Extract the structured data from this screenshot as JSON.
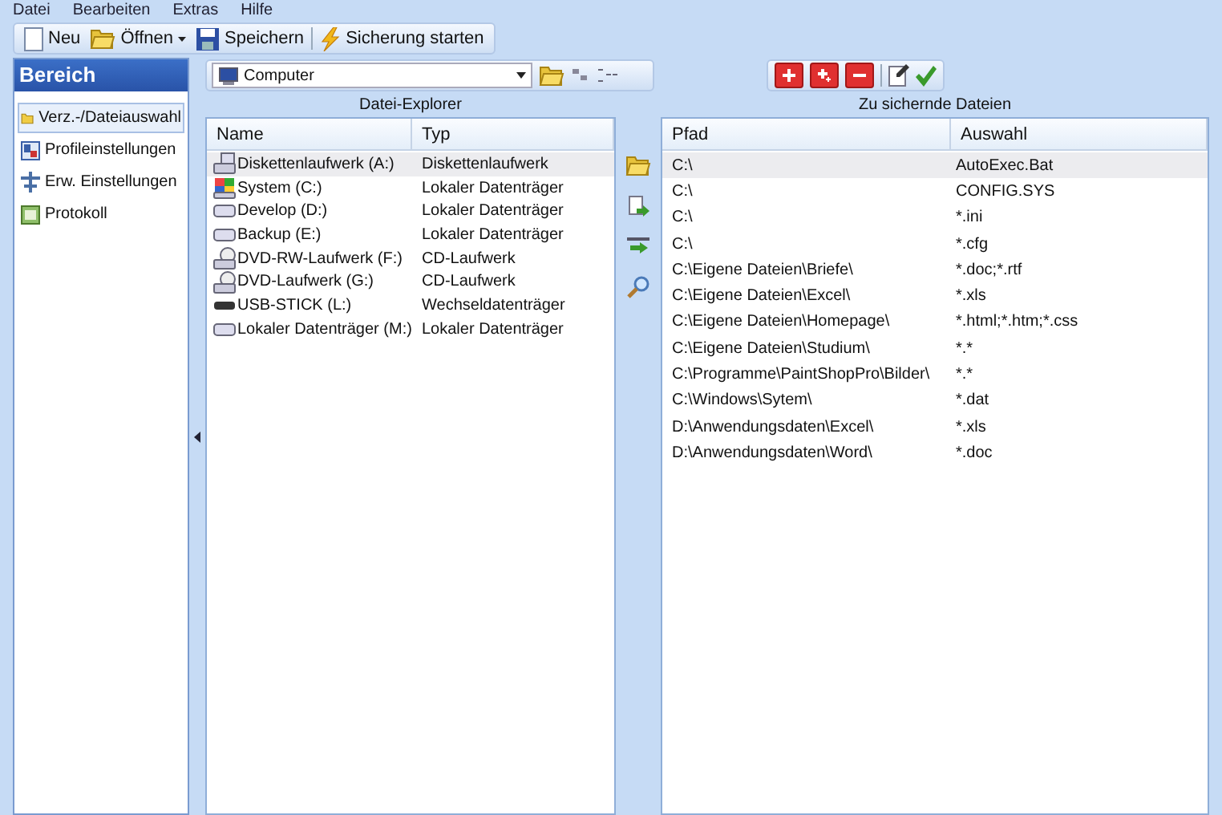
{
  "menu": [
    "Datei",
    "Bearbeiten",
    "Extras",
    "Hilfe"
  ],
  "toolbar": [
    {
      "kind": "new",
      "label": "Neu"
    },
    {
      "kind": "open",
      "label": "Öffnen",
      "dropdown": true
    },
    {
      "kind": "save",
      "label": "Speichern"
    },
    {
      "kind": "run",
      "label": "Sicherung starten"
    }
  ],
  "sidebar": {
    "title": "Bereich",
    "items": [
      {
        "kind": "folder",
        "label": "Verz.-/Dateiauswahl",
        "selected": true
      },
      {
        "kind": "profile",
        "label": "Profileinstellungen",
        "selected": false
      },
      {
        "kind": "advanced",
        "label": "Erw. Einstellungen",
        "selected": false
      },
      {
        "kind": "log",
        "label": "Protokoll",
        "selected": false
      }
    ]
  },
  "location": {
    "value": "Computer"
  },
  "explorer": {
    "title": "Datei-Explorer",
    "columns": [
      "Name",
      "Typ"
    ],
    "rows": [
      {
        "kind": "floppy",
        "name": "Diskettenlaufwerk (A:)",
        "type": "Diskettenlaufwerk",
        "selected": true
      },
      {
        "kind": "system",
        "name": "System (C:)",
        "type": "Lokaler Datenträger",
        "selected": false
      },
      {
        "kind": "disk",
        "name": "Develop (D:)",
        "type": "Lokaler Datenträger",
        "selected": false
      },
      {
        "kind": "disk",
        "name": "Backup (E:)",
        "type": "Lokaler Datenträger",
        "selected": false
      },
      {
        "kind": "dvd",
        "name": "DVD-RW-Laufwerk (F:)",
        "type": "CD-Laufwerk",
        "selected": false
      },
      {
        "kind": "dvd",
        "name": "DVD-Laufwerk (G:)",
        "type": "CD-Laufwerk",
        "selected": false
      },
      {
        "kind": "usb",
        "name": "USB-STICK (L:)",
        "type": "Wechseldatenträger",
        "selected": false
      },
      {
        "kind": "disk",
        "name": "Lokaler Datenträger (M:)",
        "type": "Lokaler Datenträger",
        "selected": false
      }
    ]
  },
  "backup": {
    "title": "Zu sichernde Dateien",
    "columns": [
      "Pfad",
      "Auswahl"
    ],
    "rows": [
      {
        "path": "C:\\",
        "selection": "AutoExec.Bat",
        "selected": true
      },
      {
        "path": "C:\\",
        "selection": "CONFIG.SYS",
        "selected": false
      },
      {
        "path": "C:\\",
        "selection": "*.ini",
        "selected": false
      },
      {
        "path": "C:\\",
        "selection": "*.cfg",
        "selected": false
      },
      {
        "path": "C:\\Eigene Dateien\\Briefe\\",
        "selection": "*.doc;*.rtf",
        "selected": false
      },
      {
        "path": "C:\\Eigene Dateien\\Excel\\",
        "selection": "*.xls",
        "selected": false
      },
      {
        "path": "C:\\Eigene Dateien\\Homepage\\",
        "selection": "*.html;*.htm;*.css",
        "selected": false
      },
      {
        "path": "C:\\Eigene Dateien\\Studium\\",
        "selection": "*.*",
        "selected": false
      },
      {
        "path": "C:\\Programme\\PaintShopPro\\Bilder\\",
        "selection": "*.*",
        "selected": false
      },
      {
        "path": "C:\\Windows\\Sytem\\",
        "selection": "*.dat",
        "selected": false
      },
      {
        "path": "D:\\Anwendungsdaten\\Excel\\",
        "selection": "*.xls",
        "selected": false
      },
      {
        "path": "D:\\Anwendungsdaten\\Word\\",
        "selection": "*.doc",
        "selected": false
      }
    ]
  }
}
